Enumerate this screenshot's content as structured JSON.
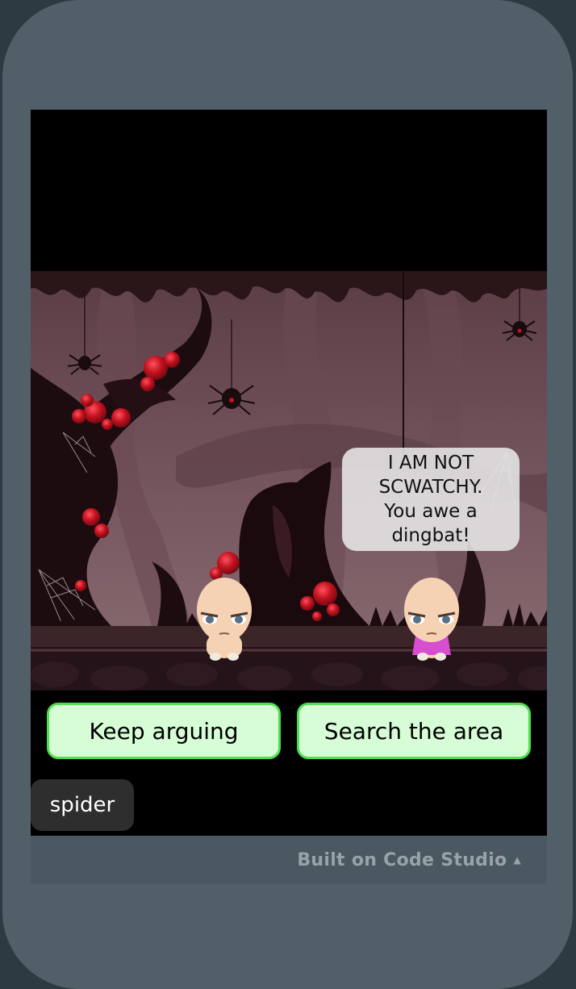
{
  "dialogue": {
    "speech": "I AM NOT SCWATCHY. You awe a dingbat!"
  },
  "choices": {
    "left": "Keep arguing",
    "right": "Search the area"
  },
  "inventory_tag": "spider",
  "footer": {
    "label": "Built on Code Studio",
    "caret_icon": "caret-up-icon"
  },
  "colors": {
    "choice_bg": "#d6fdd6",
    "choice_border": "#4de04d",
    "forest_bg": "#6e4d55",
    "berry": "#cc1422"
  }
}
